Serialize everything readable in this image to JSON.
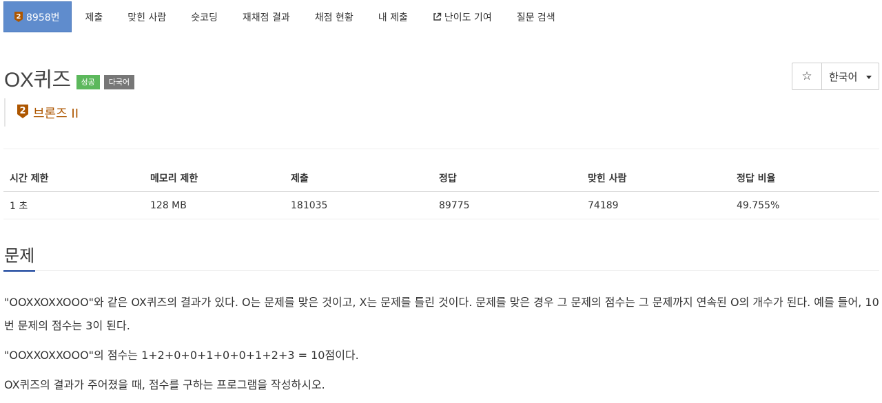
{
  "tabs": [
    {
      "label": "8958번",
      "icon": "bronze-tier-icon",
      "active": true
    },
    {
      "label": "제출"
    },
    {
      "label": "맞힌 사람"
    },
    {
      "label": "숏코딩"
    },
    {
      "label": "재채점 결과"
    },
    {
      "label": "채점 현황"
    },
    {
      "label": "내 제출"
    },
    {
      "label": "난이도 기여",
      "icon": "external-link-icon"
    },
    {
      "label": "질문 검색"
    }
  ],
  "problem": {
    "title": "OX퀴즈",
    "badges": {
      "success": "성공",
      "multilang": "다국어"
    },
    "tier": {
      "number": "2",
      "label": "브론즈 II"
    }
  },
  "controls": {
    "star": "☆",
    "language": "한국어"
  },
  "stats": {
    "headers": [
      "시간 제한",
      "메모리 제한",
      "제출",
      "정답",
      "맞힌 사람",
      "정답 비율"
    ],
    "values": [
      "1 초",
      "128 MB",
      "181035",
      "89775",
      "74189",
      "49.755%"
    ]
  },
  "section": {
    "title": "문제",
    "paragraphs": [
      "\"OOXXOXXOOO\"와 같은 OX퀴즈의 결과가 있다. O는 문제를 맞은 것이고, X는 문제를 틀린 것이다. 문제를 맞은 경우 그 문제의 점수는 그 문제까지 연속된 O의 개수가 된다. 예를 들어, 10번 문제의 점수는 3이 된다.",
      "\"OOXXOXXOOO\"의 점수는 1+2+0+0+1+0+0+1+2+3 = 10점이다.",
      "OX퀴즈의 결과가 주어졌을 때, 점수를 구하는 프로그램을 작성하시오."
    ]
  },
  "colors": {
    "active_tab": "#5f8ccd",
    "success": "#5cb85c",
    "multilang": "#777777",
    "bronze": "#ad5600",
    "accent": "#0d3a97"
  }
}
